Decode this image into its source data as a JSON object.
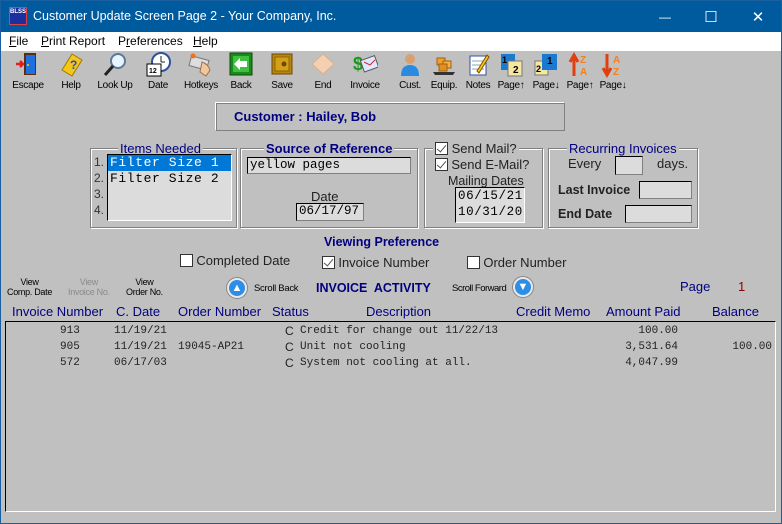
{
  "window": {
    "title": "Customer Update Screen Page 2 - Your Company, Inc.",
    "app_icon_text": "BLSS",
    "controls": {
      "minimize": "—",
      "maximize": "☐",
      "close": "✕"
    }
  },
  "menu": [
    {
      "label": "File",
      "accel": "F"
    },
    {
      "label": "Print Report",
      "accel": "P"
    },
    {
      "label": "Preferences",
      "accel": "r"
    },
    {
      "label": "Help",
      "accel": "H"
    }
  ],
  "toolbar": [
    {
      "label": "Escape",
      "icon": "door-exit-icon"
    },
    {
      "label": "Help",
      "icon": "help-book-icon"
    },
    {
      "label": "Look Up",
      "icon": "magnifier-icon"
    },
    {
      "label": "Date",
      "icon": "calendar-clock-icon"
    },
    {
      "label": "Hotkeys",
      "icon": "keyboard-hand-icon"
    },
    {
      "label": "Back",
      "icon": "back-arrow-icon"
    },
    {
      "label": "Save",
      "icon": "safe-icon"
    },
    {
      "label": "End",
      "icon": "end-icon"
    },
    {
      "label": "Invoice",
      "icon": "invoice-money-icon"
    },
    {
      "label": "Cust.",
      "icon": "customer-person-icon"
    },
    {
      "label": "Equip.",
      "icon": "equipment-boxes-icon"
    },
    {
      "label": "Notes",
      "icon": "notepad-pencil-icon"
    },
    {
      "label": "Page↑",
      "icon": "page-up-icon"
    },
    {
      "label": "Page↓",
      "icon": "page-down-icon"
    },
    {
      "label": "Page↑",
      "icon": "sort-za-icon"
    },
    {
      "label": "Page↓",
      "icon": "sort-az-icon"
    }
  ],
  "customer": {
    "label": "Customer :",
    "name": "Hailey, Bob"
  },
  "items_needed": {
    "title": "Items Needed",
    "items": [
      {
        "num": "1.",
        "value": "Filter Size 1",
        "selected": true
      },
      {
        "num": "2.",
        "value": "Filter Size 2",
        "selected": false
      },
      {
        "num": "3.",
        "value": "",
        "selected": false
      },
      {
        "num": "4.",
        "value": "",
        "selected": false
      }
    ]
  },
  "source_of_reference": {
    "title": "Source of Reference",
    "value": "yellow pages",
    "date_label": "Date",
    "date": "06/17/97"
  },
  "mailing": {
    "send_mail_label": "Send Mail?",
    "send_mail_checked": true,
    "send_email_label": "Send E-Mail?",
    "send_email_checked": true,
    "dates_label": "Mailing Dates",
    "dates": [
      "06/15/21",
      "10/31/20"
    ]
  },
  "recurring": {
    "title": "Recurring Invoices",
    "every_label": "Every",
    "every_value": "",
    "days_label": "days.",
    "last_invoice_label": "Last Invoice",
    "last_invoice_value": "",
    "end_date_label": "End Date",
    "end_date_value": ""
  },
  "viewing_preference": {
    "title": "Viewing Preference",
    "options": [
      {
        "label": "Completed Date",
        "checked": false
      },
      {
        "label": "Invoice Number",
        "checked": true
      },
      {
        "label": "Order Number",
        "checked": false
      }
    ]
  },
  "view_buttons": [
    {
      "line1": "View",
      "line2": "Comp. Date",
      "enabled": true
    },
    {
      "line1": "View",
      "line2": "Invoice No.",
      "enabled": false
    },
    {
      "line1": "View",
      "line2": "Order No.",
      "enabled": true
    }
  ],
  "activity": {
    "scroll_back_label": "Scroll Back",
    "title": "INVOICE  ACTIVITY",
    "scroll_forward_label": "Scroll Forward",
    "page_label": "Page",
    "page_number": "1",
    "columns": [
      "Invoice Number",
      "C. Date",
      "Order Number",
      "Status",
      "Description",
      "Credit Memo",
      "Amount Paid",
      "Balance"
    ],
    "rows": [
      {
        "invoice": "913",
        "cdate": "11/19/21",
        "order": "",
        "status": "C",
        "description": "Credit for change out 11/22/13",
        "credit_memo": "",
        "amount_paid": "100.00",
        "balance": ""
      },
      {
        "invoice": "905",
        "cdate": "11/19/21",
        "order": "19045-AP21",
        "status": "C",
        "description": "Unit not cooling",
        "credit_memo": "",
        "amount_paid": "3,531.64",
        "balance": "100.00"
      },
      {
        "invoice": "572",
        "cdate": "06/17/03",
        "order": "",
        "status": "C",
        "description": "System not cooling at all.",
        "credit_memo": "",
        "amount_paid": "4,047.99",
        "balance": ""
      }
    ]
  },
  "colors": {
    "titlebar": "#005a9e",
    "label_blue": "#000080",
    "page_number_red": "#8b0000",
    "selection": "#0078d7"
  }
}
